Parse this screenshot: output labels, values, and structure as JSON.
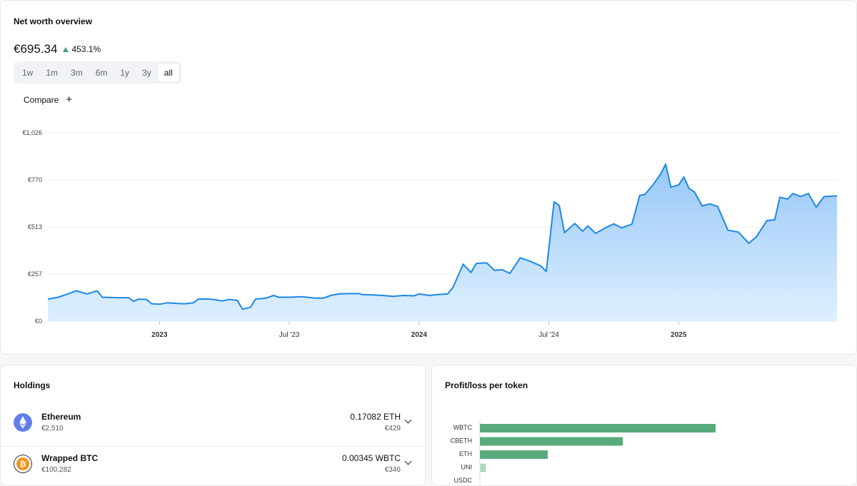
{
  "overview": {
    "title": "Net worth overview",
    "value": "€695.34",
    "change": "453.1%",
    "ranges": [
      "1w",
      "1m",
      "3m",
      "6m",
      "1y",
      "3y",
      "all"
    ],
    "active_range": "all",
    "compare_label": "Compare"
  },
  "chart_data": [
    {
      "type": "area",
      "y_ticks": [
        "€1,026",
        "€770",
        "€513",
        "€257",
        "€0"
      ],
      "ylim": [
        0,
        1026
      ],
      "x_ticks": [
        {
          "label": "2023",
          "t": 2023.0,
          "bold": true
        },
        {
          "label": "Jul '23",
          "t": 2023.5,
          "bold": false
        },
        {
          "label": "2024",
          "t": 2024.0,
          "bold": true
        },
        {
          "label": "Jul '24",
          "t": 2024.5,
          "bold": false
        },
        {
          "label": "2025",
          "t": 2025.0,
          "bold": true
        }
      ],
      "xlim": [
        2022.57,
        2025.61
      ],
      "series": [
        {
          "color": "#1e88e5",
          "points": [
            [
              2022.57,
              120
            ],
            [
              2022.61,
              130
            ],
            [
              2022.65,
              150
            ],
            [
              2022.68,
              165
            ],
            [
              2022.72,
              148
            ],
            [
              2022.76,
              165
            ],
            [
              2022.78,
              130
            ],
            [
              2022.84,
              128
            ],
            [
              2022.88,
              128
            ],
            [
              2022.9,
              108
            ],
            [
              2022.92,
              120
            ],
            [
              2022.95,
              118
            ],
            [
              2022.97,
              95
            ],
            [
              2023.0,
              92
            ],
            [
              2023.03,
              100
            ],
            [
              2023.07,
              96
            ],
            [
              2023.1,
              95
            ],
            [
              2023.13,
              100
            ],
            [
              2023.15,
              120
            ],
            [
              2023.18,
              121
            ],
            [
              2023.21,
              118
            ],
            [
              2023.24,
              110
            ],
            [
              2023.27,
              118
            ],
            [
              2023.3,
              113
            ],
            [
              2023.32,
              65
            ],
            [
              2023.35,
              75
            ],
            [
              2023.37,
              120
            ],
            [
              2023.41,
              125
            ],
            [
              2023.44,
              140
            ],
            [
              2023.46,
              130
            ],
            [
              2023.5,
              130
            ],
            [
              2023.55,
              133
            ],
            [
              2023.6,
              125
            ],
            [
              2023.63,
              125
            ],
            [
              2023.66,
              140
            ],
            [
              2023.69,
              148
            ],
            [
              2023.73,
              150
            ],
            [
              2023.77,
              150
            ],
            [
              2023.78,
              145
            ],
            [
              2023.82,
              143
            ],
            [
              2023.86,
              140
            ],
            [
              2023.9,
              135
            ],
            [
              2023.94,
              140
            ],
            [
              2023.98,
              138
            ],
            [
              2024.0,
              148
            ],
            [
              2024.04,
              140
            ],
            [
              2024.07,
              145
            ],
            [
              2024.11,
              148
            ],
            [
              2024.13,
              182
            ],
            [
              2024.17,
              310
            ],
            [
              2024.2,
              265
            ],
            [
              2024.22,
              314
            ],
            [
              2024.26,
              318
            ],
            [
              2024.29,
              277
            ],
            [
              2024.32,
              280
            ],
            [
              2024.35,
              260
            ],
            [
              2024.39,
              345
            ],
            [
              2024.43,
              325
            ],
            [
              2024.47,
              300
            ],
            [
              2024.49,
              270
            ],
            [
              2024.52,
              650
            ],
            [
              2024.54,
              630
            ],
            [
              2024.56,
              482
            ],
            [
              2024.6,
              532
            ],
            [
              2024.63,
              490
            ],
            [
              2024.65,
              518
            ],
            [
              2024.68,
              478
            ],
            [
              2024.72,
              510
            ],
            [
              2024.75,
              530
            ],
            [
              2024.78,
              508
            ],
            [
              2024.82,
              528
            ],
            [
              2024.85,
              685
            ],
            [
              2024.87,
              690
            ],
            [
              2024.9,
              740
            ],
            [
              2024.93,
              800
            ],
            [
              2024.95,
              855
            ],
            [
              2024.97,
              730
            ],
            [
              2025.0,
              742
            ],
            [
              2025.02,
              785
            ],
            [
              2025.04,
              722
            ],
            [
              2025.06,
              705
            ],
            [
              2025.09,
              628
            ],
            [
              2025.12,
              638
            ],
            [
              2025.15,
              625
            ],
            [
              2025.19,
              495
            ],
            [
              2025.23,
              485
            ],
            [
              2025.27,
              424
            ],
            [
              2025.3,
              460
            ],
            [
              2025.34,
              548
            ],
            [
              2025.37,
              552
            ],
            [
              2025.39,
              675
            ],
            [
              2025.42,
              665
            ],
            [
              2025.44,
              695
            ],
            [
              2025.47,
              679
            ],
            [
              2025.5,
              695
            ],
            [
              2025.53,
              620
            ],
            [
              2025.56,
              678
            ],
            [
              2025.61,
              682
            ]
          ]
        }
      ]
    },
    {
      "type": "bar",
      "orientation": "horizontal",
      "title": "Profit/loss per token",
      "categories": [
        "WBTC",
        "CBETH",
        "ETH",
        "UNI",
        "USDC"
      ],
      "values": [
        330,
        200,
        95,
        8,
        0
      ],
      "xlim": [
        0,
        440
      ],
      "color": "#5aab7b"
    }
  ],
  "holdings": {
    "title": "Holdings",
    "items": [
      {
        "name": "Ethereum",
        "price": "€2,510",
        "amount": "0.17082 ETH",
        "value": "€429",
        "icon": "ethereum-icon",
        "color": "#627eea"
      },
      {
        "name": "Wrapped BTC",
        "price": "€100,282",
        "amount": "0.00345 WBTC",
        "value": "€346",
        "icon": "bitcoin-icon",
        "color": "#f7931a"
      }
    ]
  },
  "pl": {
    "title": "Profit/loss per token"
  },
  "colors": {
    "line": "#1e88e5",
    "bar": "#5aab7b",
    "up": "#3aa36b"
  }
}
